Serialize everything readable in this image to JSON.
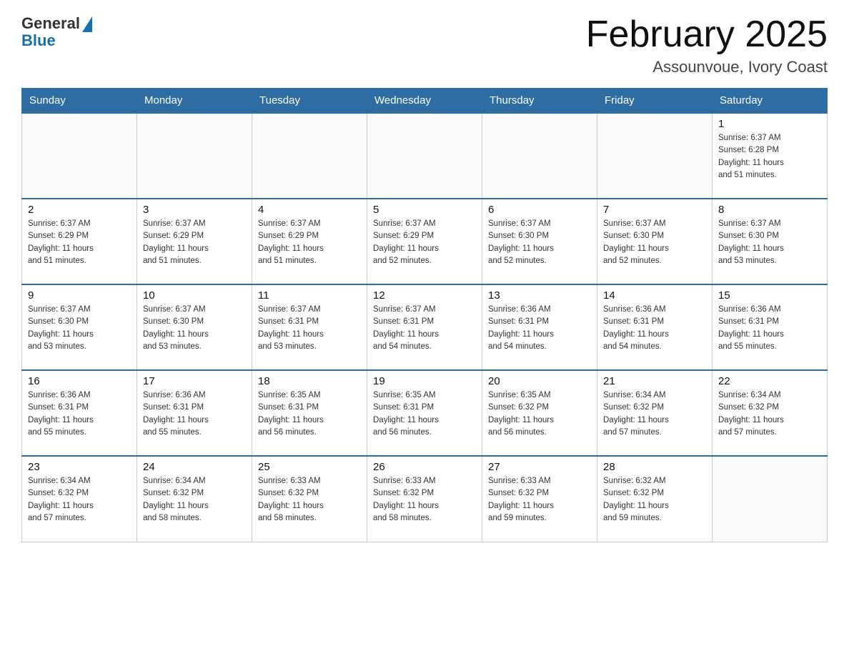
{
  "logo": {
    "general": "General",
    "blue": "Blue"
  },
  "title": "February 2025",
  "subtitle": "Assounvoue, Ivory Coast",
  "days_header": [
    "Sunday",
    "Monday",
    "Tuesday",
    "Wednesday",
    "Thursday",
    "Friday",
    "Saturday"
  ],
  "weeks": [
    [
      {
        "day": "",
        "info": ""
      },
      {
        "day": "",
        "info": ""
      },
      {
        "day": "",
        "info": ""
      },
      {
        "day": "",
        "info": ""
      },
      {
        "day": "",
        "info": ""
      },
      {
        "day": "",
        "info": ""
      },
      {
        "day": "1",
        "info": "Sunrise: 6:37 AM\nSunset: 6:28 PM\nDaylight: 11 hours\nand 51 minutes."
      }
    ],
    [
      {
        "day": "2",
        "info": "Sunrise: 6:37 AM\nSunset: 6:29 PM\nDaylight: 11 hours\nand 51 minutes."
      },
      {
        "day": "3",
        "info": "Sunrise: 6:37 AM\nSunset: 6:29 PM\nDaylight: 11 hours\nand 51 minutes."
      },
      {
        "day": "4",
        "info": "Sunrise: 6:37 AM\nSunset: 6:29 PM\nDaylight: 11 hours\nand 51 minutes."
      },
      {
        "day": "5",
        "info": "Sunrise: 6:37 AM\nSunset: 6:29 PM\nDaylight: 11 hours\nand 52 minutes."
      },
      {
        "day": "6",
        "info": "Sunrise: 6:37 AM\nSunset: 6:30 PM\nDaylight: 11 hours\nand 52 minutes."
      },
      {
        "day": "7",
        "info": "Sunrise: 6:37 AM\nSunset: 6:30 PM\nDaylight: 11 hours\nand 52 minutes."
      },
      {
        "day": "8",
        "info": "Sunrise: 6:37 AM\nSunset: 6:30 PM\nDaylight: 11 hours\nand 53 minutes."
      }
    ],
    [
      {
        "day": "9",
        "info": "Sunrise: 6:37 AM\nSunset: 6:30 PM\nDaylight: 11 hours\nand 53 minutes."
      },
      {
        "day": "10",
        "info": "Sunrise: 6:37 AM\nSunset: 6:30 PM\nDaylight: 11 hours\nand 53 minutes."
      },
      {
        "day": "11",
        "info": "Sunrise: 6:37 AM\nSunset: 6:31 PM\nDaylight: 11 hours\nand 53 minutes."
      },
      {
        "day": "12",
        "info": "Sunrise: 6:37 AM\nSunset: 6:31 PM\nDaylight: 11 hours\nand 54 minutes."
      },
      {
        "day": "13",
        "info": "Sunrise: 6:36 AM\nSunset: 6:31 PM\nDaylight: 11 hours\nand 54 minutes."
      },
      {
        "day": "14",
        "info": "Sunrise: 6:36 AM\nSunset: 6:31 PM\nDaylight: 11 hours\nand 54 minutes."
      },
      {
        "day": "15",
        "info": "Sunrise: 6:36 AM\nSunset: 6:31 PM\nDaylight: 11 hours\nand 55 minutes."
      }
    ],
    [
      {
        "day": "16",
        "info": "Sunrise: 6:36 AM\nSunset: 6:31 PM\nDaylight: 11 hours\nand 55 minutes."
      },
      {
        "day": "17",
        "info": "Sunrise: 6:36 AM\nSunset: 6:31 PM\nDaylight: 11 hours\nand 55 minutes."
      },
      {
        "day": "18",
        "info": "Sunrise: 6:35 AM\nSunset: 6:31 PM\nDaylight: 11 hours\nand 56 minutes."
      },
      {
        "day": "19",
        "info": "Sunrise: 6:35 AM\nSunset: 6:31 PM\nDaylight: 11 hours\nand 56 minutes."
      },
      {
        "day": "20",
        "info": "Sunrise: 6:35 AM\nSunset: 6:32 PM\nDaylight: 11 hours\nand 56 minutes."
      },
      {
        "day": "21",
        "info": "Sunrise: 6:34 AM\nSunset: 6:32 PM\nDaylight: 11 hours\nand 57 minutes."
      },
      {
        "day": "22",
        "info": "Sunrise: 6:34 AM\nSunset: 6:32 PM\nDaylight: 11 hours\nand 57 minutes."
      }
    ],
    [
      {
        "day": "23",
        "info": "Sunrise: 6:34 AM\nSunset: 6:32 PM\nDaylight: 11 hours\nand 57 minutes."
      },
      {
        "day": "24",
        "info": "Sunrise: 6:34 AM\nSunset: 6:32 PM\nDaylight: 11 hours\nand 58 minutes."
      },
      {
        "day": "25",
        "info": "Sunrise: 6:33 AM\nSunset: 6:32 PM\nDaylight: 11 hours\nand 58 minutes."
      },
      {
        "day": "26",
        "info": "Sunrise: 6:33 AM\nSunset: 6:32 PM\nDaylight: 11 hours\nand 58 minutes."
      },
      {
        "day": "27",
        "info": "Sunrise: 6:33 AM\nSunset: 6:32 PM\nDaylight: 11 hours\nand 59 minutes."
      },
      {
        "day": "28",
        "info": "Sunrise: 6:32 AM\nSunset: 6:32 PM\nDaylight: 11 hours\nand 59 minutes."
      },
      {
        "day": "",
        "info": ""
      }
    ]
  ]
}
